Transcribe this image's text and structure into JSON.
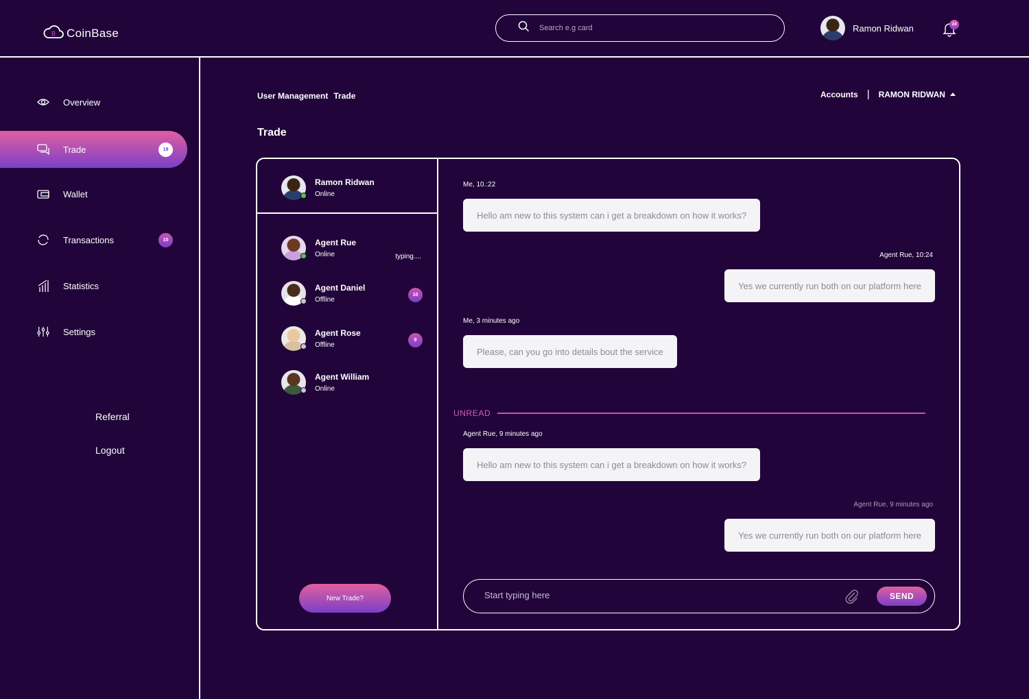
{
  "brand": {
    "name": "CoinBase",
    "logo_icon": "cloud-b-logo-icon"
  },
  "search": {
    "placeholder": "Search e.g card",
    "icon": "search-icon"
  },
  "user": {
    "name": "Ramon Ridwan",
    "notifications": "24"
  },
  "sidebar": {
    "items": [
      {
        "label": "Overview",
        "icon": "eye-icon",
        "badge": ""
      },
      {
        "label": "Trade",
        "icon": "chat-icon",
        "badge": "19",
        "active": true
      },
      {
        "label": "Wallet",
        "icon": "wallet-icon",
        "badge": ""
      },
      {
        "label": "Transactions",
        "icon": "refresh-icon",
        "badge": "10"
      },
      {
        "label": "Statistics",
        "icon": "chart-icon",
        "badge": ""
      },
      {
        "label": "Settings",
        "icon": "sliders-icon",
        "badge": ""
      }
    ],
    "referral": "Referral",
    "logout": "Logout"
  },
  "breadcrumb": {
    "section": "User Management",
    "current": "Trade"
  },
  "accounts": {
    "label": "Accounts",
    "name": "RAMON RIDWAN"
  },
  "page_title": "Trade",
  "contacts": {
    "me": {
      "name": "Ramon Ridwan",
      "status": "Online"
    },
    "list": [
      {
        "name": "Agent Rue",
        "status": "Online",
        "typing": "typing....",
        "badge": ""
      },
      {
        "name": "Agent Daniel",
        "status": "Offline",
        "typing": "",
        "badge": "10"
      },
      {
        "name": "Agent Rose",
        "status": "Offline",
        "typing": "",
        "badge": "9"
      },
      {
        "name": "Agent William",
        "status": "Online",
        "typing": "",
        "badge": ""
      }
    ],
    "new_trade": "New Trade?"
  },
  "chat": {
    "messages": [
      {
        "meta": "Me, 10.:22",
        "text": "Hello am new to this system can i get a breakdown on how it works?"
      },
      {
        "meta": "Agent Rue, 10:24",
        "text": "Yes we currently run both on our platform here"
      },
      {
        "meta": "Me, 3 minutes ago",
        "text": "Please, can you go into details bout the service"
      },
      {
        "meta": "Agent Rue, 9 minutes ago",
        "text": "Hello am new to this system can i get a breakdown on how it works?"
      },
      {
        "meta": "Agent Rue, 9 minutes ago",
        "text": "Yes we currently run both on our platform here"
      }
    ],
    "unread_label": "UNREAD",
    "composer_placeholder": "Start typing here",
    "send_label": "SEND"
  },
  "colors": {
    "background": "#21053a",
    "accent_start": "#e0609e",
    "accent_end": "#7c3fc9",
    "online": "#3fd13f"
  }
}
